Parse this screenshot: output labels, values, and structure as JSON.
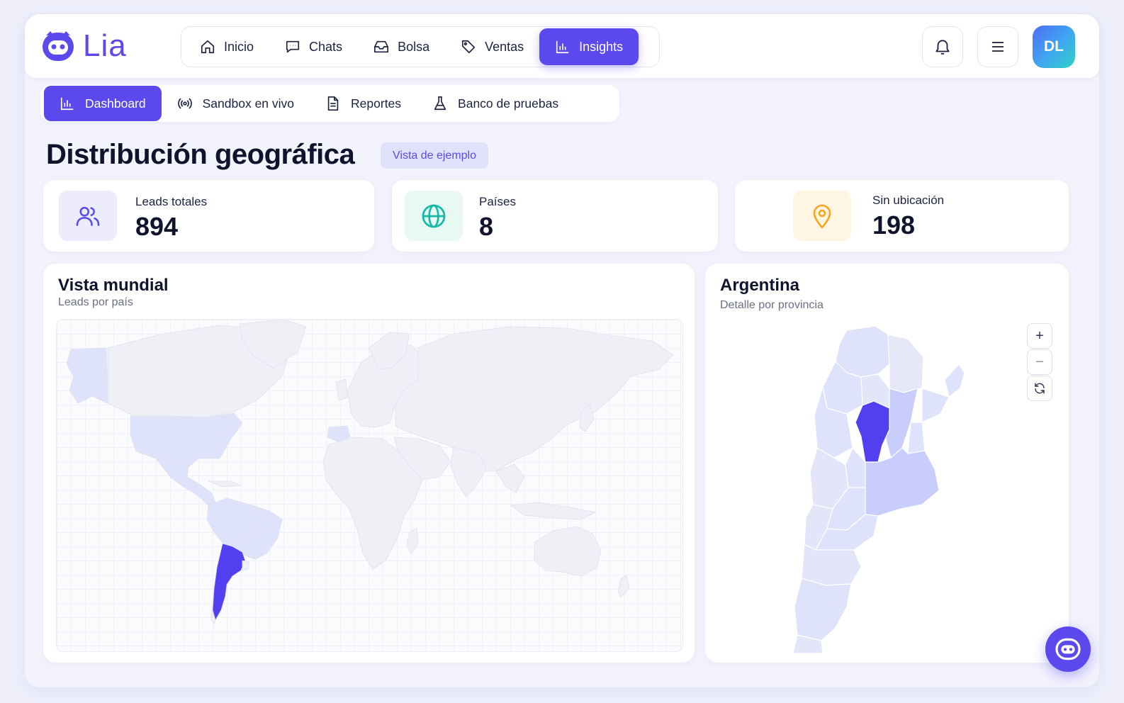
{
  "app": {
    "name": "Lia"
  },
  "main_nav": {
    "items": [
      {
        "label": "Inicio",
        "icon": "home-icon"
      },
      {
        "label": "Chats",
        "icon": "chat-icon"
      },
      {
        "label": "Bolsa",
        "icon": "inbox-icon"
      },
      {
        "label": "Ventas",
        "icon": "tag-icon"
      },
      {
        "label": "Insights",
        "icon": "bar-chart-icon",
        "active": true
      }
    ]
  },
  "user": {
    "initials": "DL"
  },
  "sub_nav": {
    "items": [
      {
        "label": "Dashboard",
        "icon": "bar-chart-icon",
        "active": true
      },
      {
        "label": "Sandbox en vivo",
        "icon": "broadcast-icon"
      },
      {
        "label": "Reportes",
        "icon": "document-icon"
      },
      {
        "label": "Banco de pruebas",
        "icon": "flask-icon"
      }
    ]
  },
  "page": {
    "title": "Distribución geográfica",
    "badge": "Vista de ejemplo"
  },
  "stats": [
    {
      "label": "Leads totales",
      "value": "894",
      "icon": "users-icon",
      "color": "#5b49ee"
    },
    {
      "label": "Países",
      "value": "8",
      "icon": "globe-icon",
      "color": "#14b8a6"
    },
    {
      "label": "Sin ubicación",
      "value": "198",
      "icon": "map-pin-icon",
      "color": "#f5a623"
    }
  ],
  "world_panel": {
    "title": "Vista mundial",
    "subtitle": "Leads por país"
  },
  "argentina_panel": {
    "title": "Argentina",
    "subtitle": "Detalle por provincia"
  },
  "zoom_controls": {
    "zoom_in": "+",
    "zoom_out": "−"
  },
  "colors": {
    "accent": "#5b49ee",
    "map_high": "#5240f0",
    "map_mid": "#c9cdfb",
    "map_low": "#dfe2fb",
    "map_empty": "#eef0f6"
  }
}
